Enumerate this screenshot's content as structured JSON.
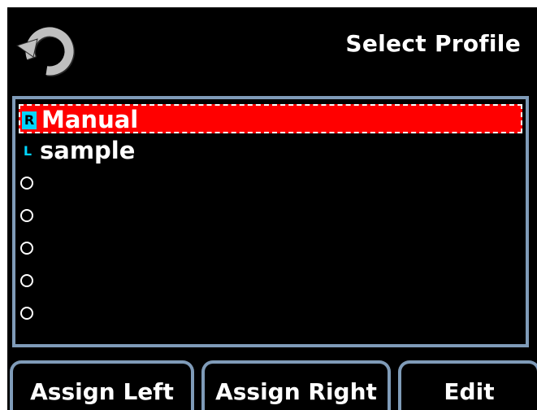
{
  "header": {
    "title": "Select Profile",
    "back_icon": "refresh-arrow-icon"
  },
  "profiles": [
    {
      "marker": "R",
      "label": "Manual",
      "selected": true
    },
    {
      "marker": "L",
      "label": "sample",
      "selected": false
    },
    {
      "marker": "",
      "label": "",
      "selected": false
    },
    {
      "marker": "",
      "label": "",
      "selected": false
    },
    {
      "marker": "",
      "label": "",
      "selected": false
    },
    {
      "marker": "",
      "label": "",
      "selected": false
    },
    {
      "marker": "",
      "label": "",
      "selected": false
    }
  ],
  "softkeys": {
    "assign_left": "Assign Left",
    "assign_right": "Assign Right",
    "edit": "Edit"
  },
  "colors": {
    "background": "#000000",
    "selection": "#ff0000",
    "border": "#7f9bb8",
    "marker_accent": "#00d5ff",
    "icon_gray": "#bfbfbf",
    "text": "#ffffff"
  }
}
